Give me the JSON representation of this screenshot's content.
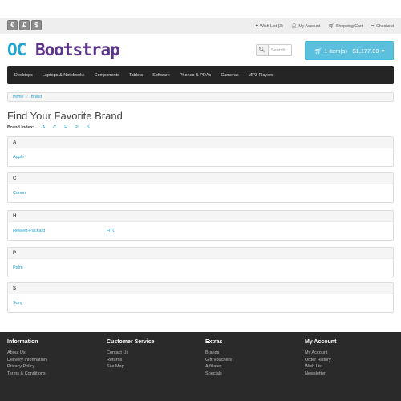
{
  "currency": [
    "€",
    "£",
    "$"
  ],
  "toplinks": {
    "wishlist": "Wish List (3)",
    "account": "My Account",
    "cart": "Shopping Cart",
    "checkout": "Checkout"
  },
  "logo": {
    "part1": "OC",
    "part2": "Bootstrap"
  },
  "search": {
    "placeholder": "Search"
  },
  "cart_button": {
    "label": "1 item(s) - $1,177.00"
  },
  "nav": [
    "Desktops",
    "Laptops & Notebooks",
    "Components",
    "Tablets",
    "Software",
    "Phones & PDAs",
    "Cameras",
    "MP3 Players"
  ],
  "breadcrumb": [
    "Home",
    "Brand"
  ],
  "page_title": "Find Your Favorite Brand",
  "brand_index": {
    "label": "Brand Index:",
    "letters": [
      "A",
      "C",
      "H",
      "P",
      "S"
    ]
  },
  "groups": [
    {
      "letter": "A",
      "brands": [
        "Apple"
      ]
    },
    {
      "letter": "C",
      "brands": [
        "Canon"
      ]
    },
    {
      "letter": "H",
      "brands": [
        "Hewlett-Packard",
        "HTC"
      ]
    },
    {
      "letter": "P",
      "brands": [
        "Palm"
      ]
    },
    {
      "letter": "S",
      "brands": [
        "Sony"
      ]
    }
  ],
  "footer": {
    "information": {
      "title": "Information",
      "links": [
        "About Us",
        "Delivery Information",
        "Privacy Policy",
        "Terms & Conditions"
      ]
    },
    "service": {
      "title": "Customer Service",
      "links": [
        "Contact Us",
        "Returns",
        "Site Map"
      ]
    },
    "extras": {
      "title": "Extras",
      "links": [
        "Brands",
        "Gift Vouchers",
        "Affiliates",
        "Specials"
      ]
    },
    "account": {
      "title": "My Account",
      "links": [
        "My Account",
        "Order History",
        "Wish List",
        "Newsletter"
      ]
    }
  },
  "colors": {
    "accent": "#23a1d1",
    "logo_purple": "#5b3489",
    "cart": "#5bc0de",
    "navbar": "#252525",
    "footer": "#2a2a2a"
  }
}
